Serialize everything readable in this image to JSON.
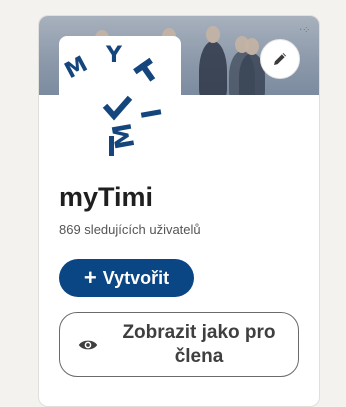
{
  "company": {
    "name": "myTimi",
    "followers_text": "869 sledujících uživatelů",
    "logo_text": "MY TIMI"
  },
  "actions": {
    "create_label": "Vytvořit",
    "view_as_member_label": "Zobrazit jako pro člena"
  },
  "colors": {
    "primary": "#0a4584",
    "logo_blue": "#14467d",
    "page_bg": "#f4f2ee"
  },
  "icons": {
    "edit": "pencil-icon",
    "create": "plus-icon",
    "view": "eye-icon"
  }
}
